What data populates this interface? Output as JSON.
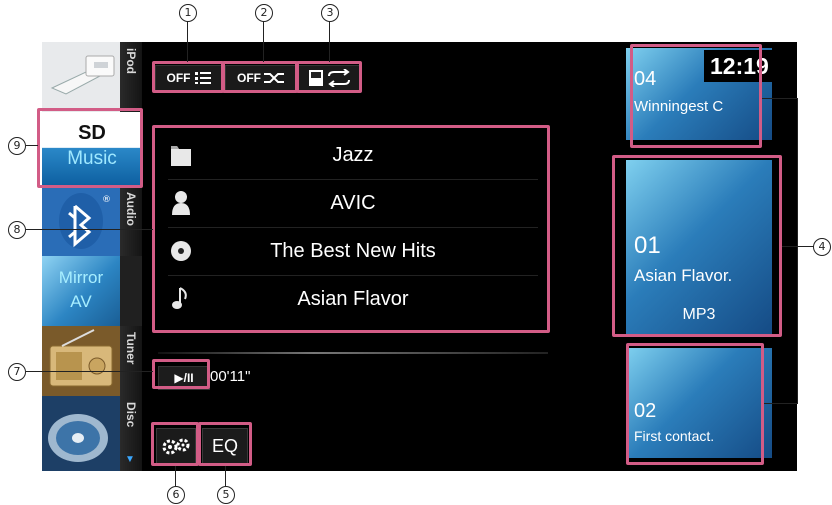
{
  "sidebar": {
    "items": [
      {
        "label": "iPod",
        "icon": "connector-cable-icon"
      },
      {
        "label": "SD",
        "label2": "Music",
        "icon": "sd-music-icon"
      },
      {
        "label": "Audio",
        "icon": "bluetooth-icon"
      },
      {
        "label": "Mirror",
        "label2": "AV",
        "icon": "mirror-av-icon"
      },
      {
        "label": "Tuner",
        "icon": "radio-icon"
      },
      {
        "label": "Disc",
        "icon": "disc-icon"
      }
    ]
  },
  "header": {
    "shuffle": {
      "off": "OFF",
      "icon": "shuffle-list-icon"
    },
    "random": {
      "off": "OFF",
      "icon": "random-cross-icon"
    },
    "repeat": {
      "icon": "repeat-folder-icon"
    }
  },
  "library": {
    "rows": [
      {
        "icon": "folder-icon",
        "text": "Jazz"
      },
      {
        "icon": "artist-icon",
        "text": "AVIC"
      },
      {
        "icon": "album-icon",
        "text": "The Best New Hits"
      },
      {
        "icon": "song-icon",
        "text": "Asian Flavor"
      }
    ]
  },
  "playback": {
    "play_label": "▶/II",
    "elapsed": "00'11\""
  },
  "bottom": {
    "eq_label": "EQ"
  },
  "tracks": {
    "prev": {
      "num": "04",
      "title": "Winningest C"
    },
    "current": {
      "num": "01",
      "title": "Asian Flavor.",
      "format": "MP3"
    },
    "next": {
      "num": "02",
      "title": "First contact."
    }
  },
  "clock": "12:19",
  "callouts": [
    "1",
    "2",
    "3",
    "4",
    "5",
    "6",
    "7",
    "8",
    "9"
  ],
  "colors": {
    "highlight": "#d25c86",
    "accent": "#2b7dba"
  }
}
